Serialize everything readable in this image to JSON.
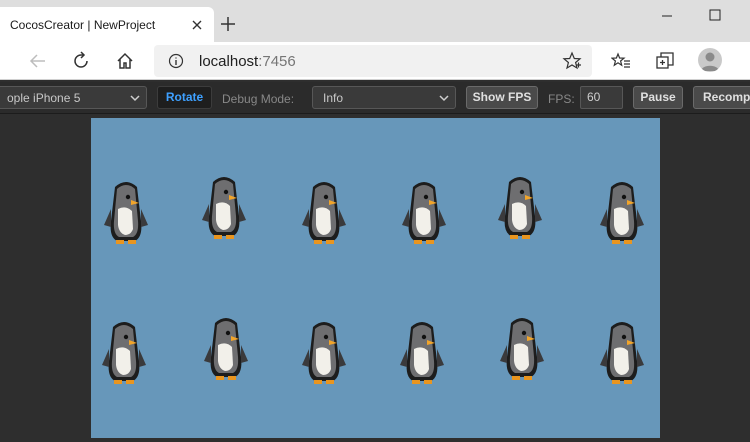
{
  "browser": {
    "tab_title": "CocosCreator | NewProject",
    "url_host": "localhost",
    "url_port": ":7456"
  },
  "icons": [
    "close-icon",
    "plus-icon",
    "minimize-icon",
    "maximize-icon",
    "back-icon",
    "forward-icon",
    "reload-icon",
    "home-icon",
    "info-icon",
    "star-icon",
    "favorites-icon",
    "collections-icon",
    "profile-icon",
    "chevron-down-icon",
    "penguin-sprite"
  ],
  "preview": {
    "device": "ople iPhone 5",
    "rotate_label": "Rotate",
    "debug_mode_label": "Debug Mode:",
    "debug_mode_value": "Info",
    "show_fps_label": "Show FPS",
    "fps_label": "FPS:",
    "fps_value": "60",
    "pause_label": "Pause",
    "recompile_label": "Recomp"
  },
  "colors": {
    "stage_bg": "#6797ba",
    "accent_blue": "#3ea0ff"
  }
}
